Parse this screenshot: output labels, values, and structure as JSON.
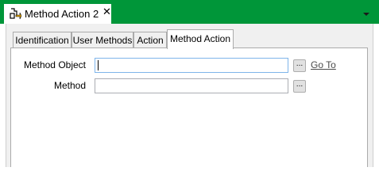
{
  "document_tab": {
    "title": "Method Action 2",
    "close_glyph": "✕",
    "icon": "method-action-icon"
  },
  "tabs": [
    {
      "label": "Identification",
      "active": false
    },
    {
      "label": "User Methods",
      "active": false
    },
    {
      "label": "Action",
      "active": false
    },
    {
      "label": "Method Action",
      "active": true
    }
  ],
  "form": {
    "method_object_label": "Method Object",
    "method_object_value": "",
    "method_label": "Method",
    "method_value": "",
    "browse_label": "...",
    "goto_label": "Go To"
  },
  "colors": {
    "title_bar": "#009639",
    "link": "#4a4a4a"
  }
}
